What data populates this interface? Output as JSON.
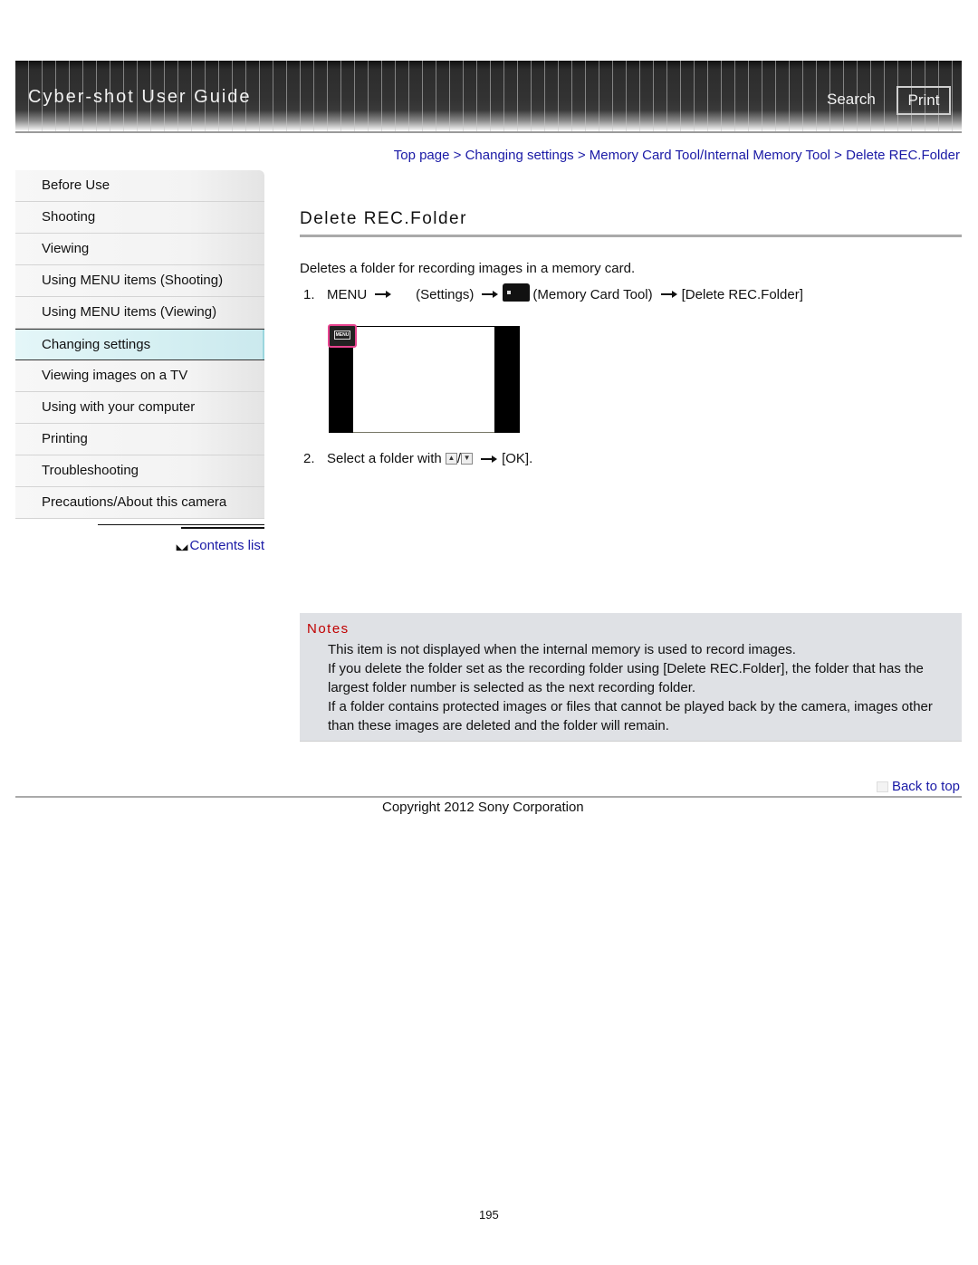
{
  "header": {
    "title": "Cyber-shot User Guide",
    "search_label": "Search",
    "print_label": "Print"
  },
  "breadcrumb": {
    "items": [
      "Top page",
      "Changing settings",
      "Memory Card Tool/Internal Memory Tool",
      "Delete REC.Folder"
    ],
    "separator": ">"
  },
  "sidebar": {
    "items": [
      {
        "label": "Before Use"
      },
      {
        "label": "Shooting"
      },
      {
        "label": "Viewing"
      },
      {
        "label": "Using MENU items (Shooting)"
      },
      {
        "label": "Using MENU items (Viewing)"
      },
      {
        "label": "Changing settings",
        "active": true
      },
      {
        "label": "Viewing images on a TV"
      },
      {
        "label": "Using with your computer"
      },
      {
        "label": "Printing"
      },
      {
        "label": "Troubleshooting"
      },
      {
        "label": "Precautions/About this camera"
      }
    ],
    "contents_link": "Contents list"
  },
  "main": {
    "heading": "Delete REC.Folder",
    "intro": "Deletes a folder for recording images in a memory card.",
    "step1": {
      "number": "1.",
      "menu": "MENU",
      "settings": "(Settings)",
      "memory_card_tool": "(Memory Card Tool)",
      "target": "[Delete REC.Folder]"
    },
    "illustration": {
      "menu_badge": "MENU"
    },
    "step2": {
      "number": "2.",
      "text": "Select a folder with",
      "up_icon": "▲",
      "slash": "/",
      "down_icon": "▼",
      "ok": "[OK]."
    }
  },
  "notes": {
    "title": "Notes",
    "items": [
      "This item is not displayed when the internal memory is used to record images.",
      "If you delete the folder set as the recording folder using [Delete REC.Folder], the folder that has the largest folder number is selected as the next recording folder.",
      "If a folder contains protected images or files that cannot be played back by the camera, images other than these images are deleted and the folder will remain."
    ]
  },
  "footer": {
    "back_to_top": "Back to top",
    "copyright": "Copyright 2012 Sony Corporation",
    "page_number": "195"
  },
  "colors": {
    "link": "#1a1aa6",
    "notes_title": "#c00000",
    "notes_bg": "#dfe1e5",
    "highlight": "#e8438f",
    "active_sidebar": "#d4eff2"
  }
}
